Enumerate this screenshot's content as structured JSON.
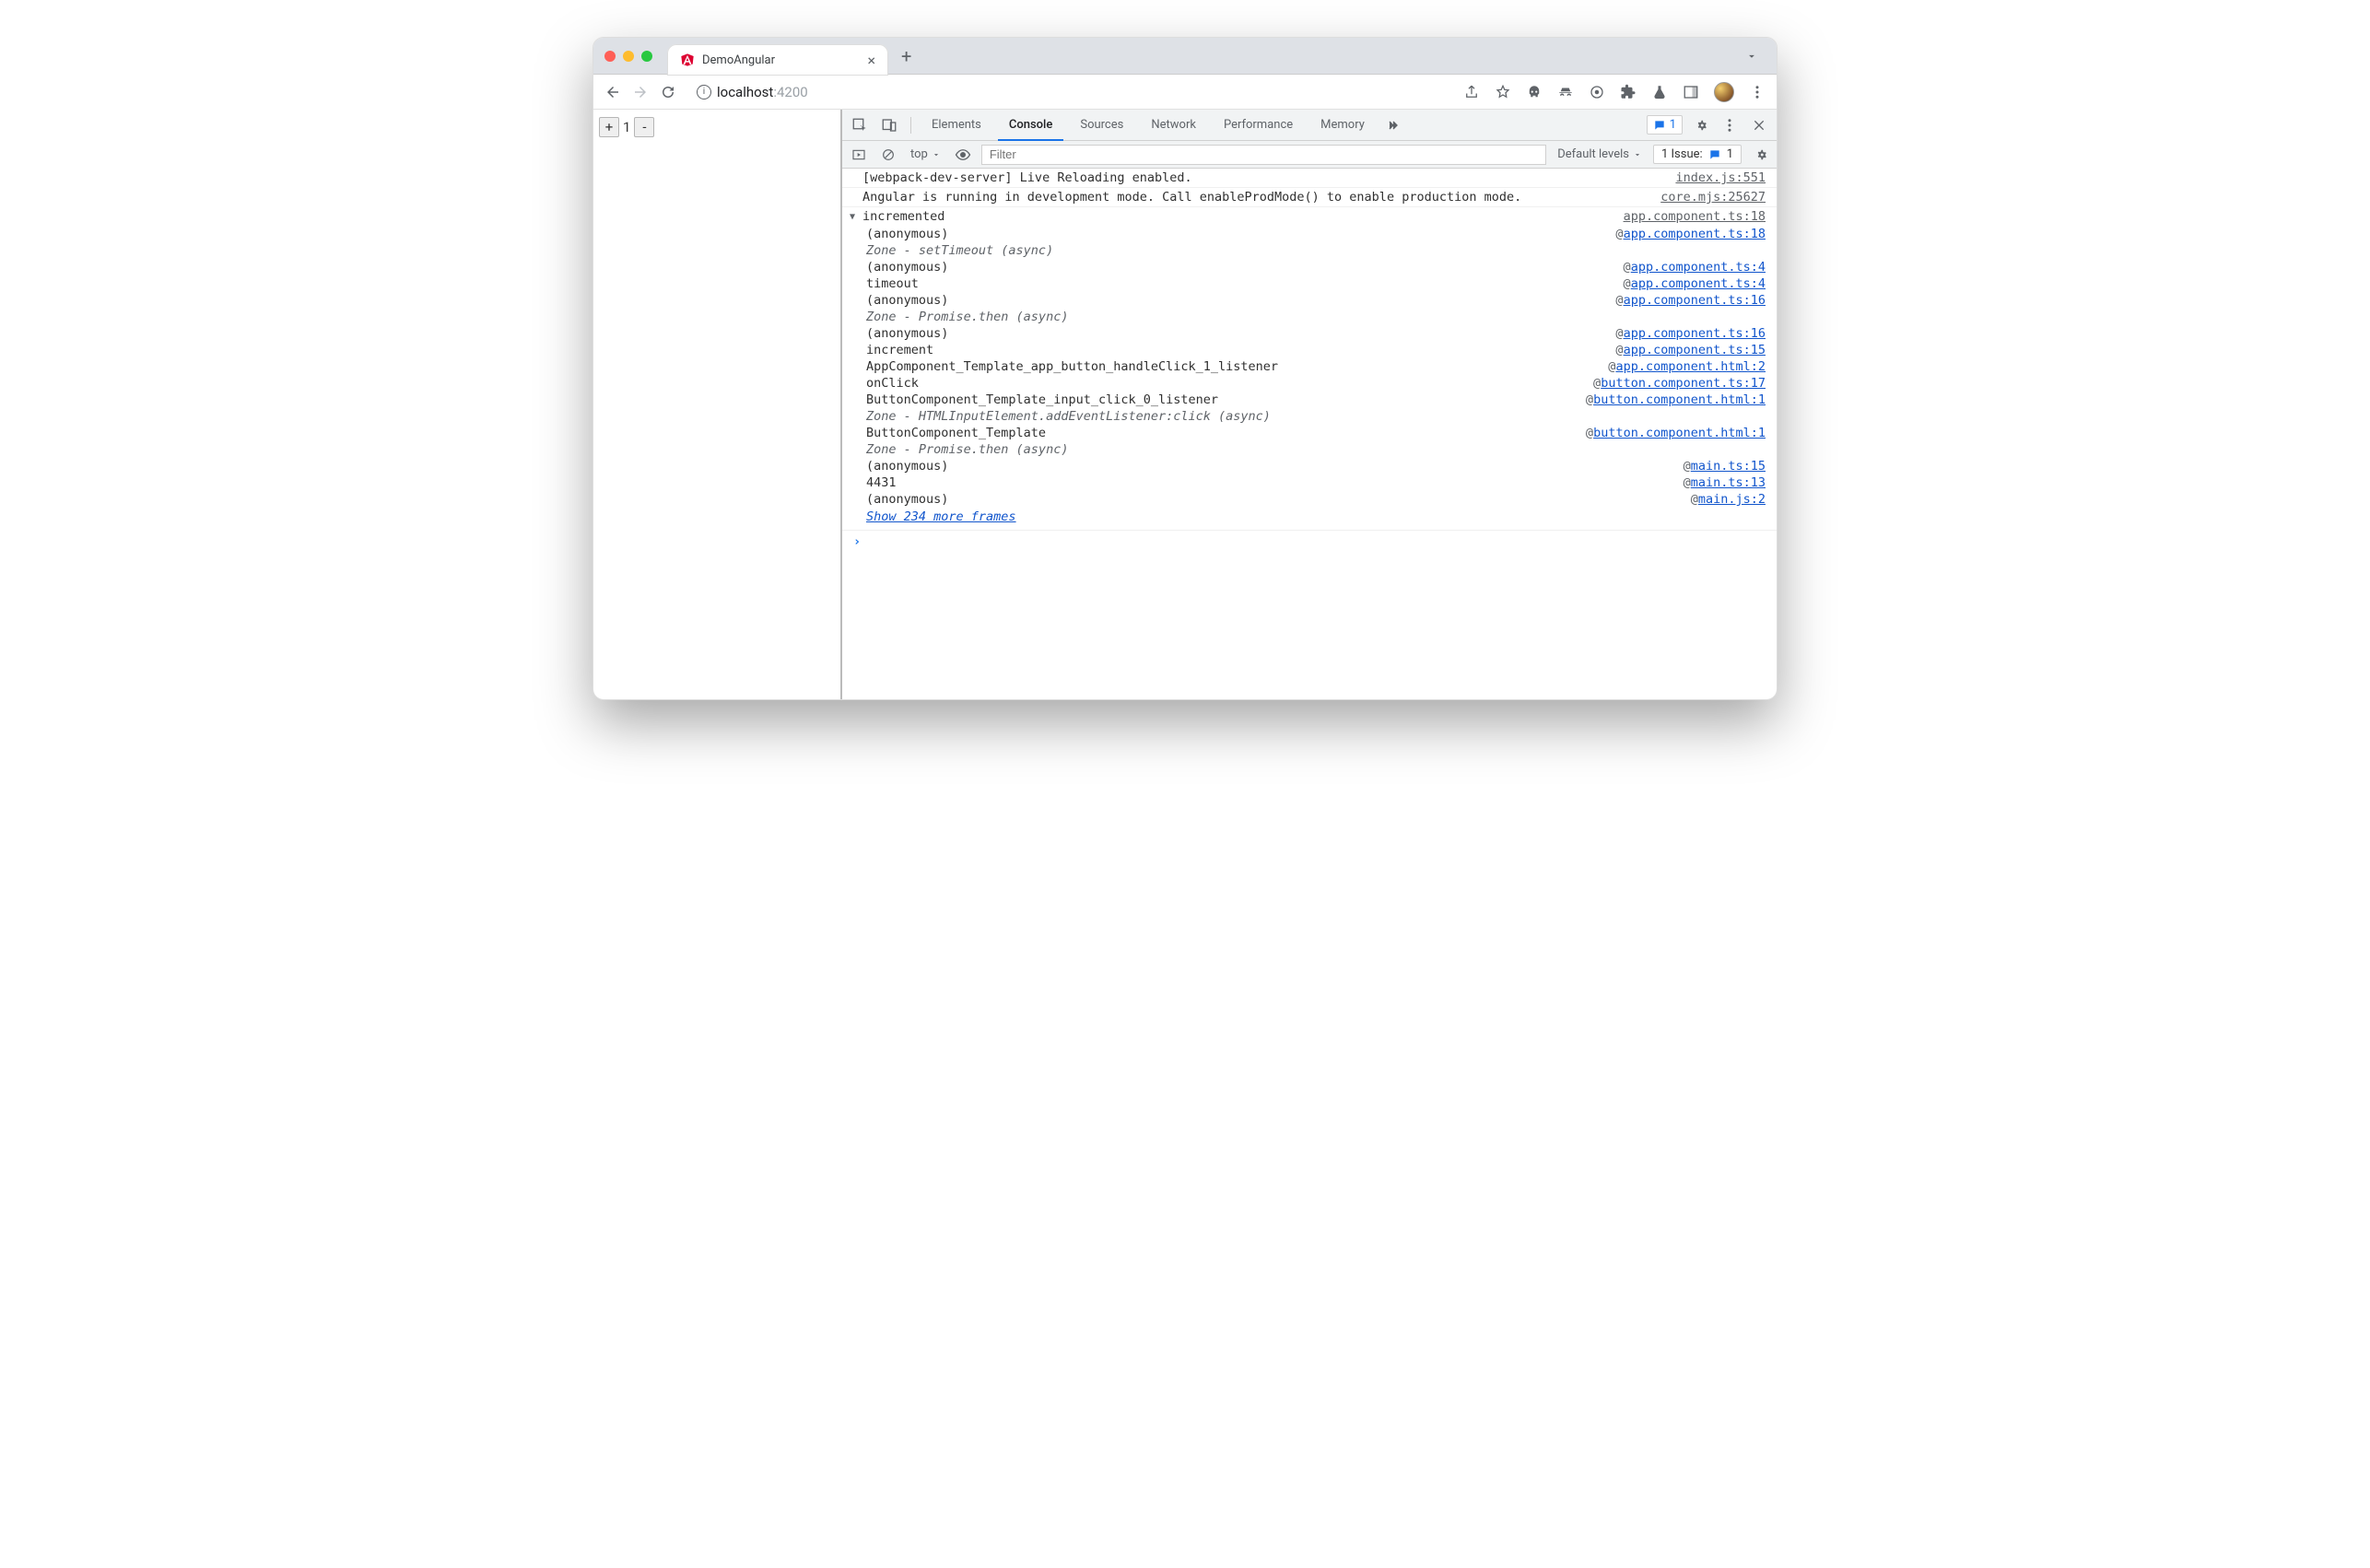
{
  "tab": {
    "title": "DemoAngular"
  },
  "url": {
    "insecure_label": "i",
    "host": "localhost",
    "port": ":4200"
  },
  "counter": {
    "plus": "+",
    "minus": "-",
    "value": "1"
  },
  "devtools": {
    "tabs": [
      "Elements",
      "Console",
      "Sources",
      "Network",
      "Performance",
      "Memory"
    ],
    "active_tab": "Console",
    "msg_badge": "1",
    "toolbar": {
      "context": "top",
      "filter_placeholder": "Filter",
      "levels": "Default levels",
      "issues_label": "1 Issue:",
      "issues_count": "1"
    }
  },
  "console": {
    "rows": [
      {
        "msg": "[webpack-dev-server] Live Reloading enabled.",
        "src": "index.js:551"
      },
      {
        "msg": "Angular is running in development mode. Call enableProdMode() to enable production mode.",
        "src": "core.mjs:25627"
      }
    ],
    "trace": {
      "label": "incremented",
      "src": "app.component.ts:18",
      "frames": [
        {
          "type": "frame",
          "fn": "(anonymous)",
          "loc": "app.component.ts:18"
        },
        {
          "type": "zone",
          "text": "Zone - setTimeout (async)"
        },
        {
          "type": "frame",
          "fn": "(anonymous)",
          "loc": "app.component.ts:4"
        },
        {
          "type": "frame",
          "fn": "timeout",
          "loc": "app.component.ts:4"
        },
        {
          "type": "frame",
          "fn": "(anonymous)",
          "loc": "app.component.ts:16"
        },
        {
          "type": "zone",
          "text": "Zone - Promise.then (async)"
        },
        {
          "type": "frame",
          "fn": "(anonymous)",
          "loc": "app.component.ts:16"
        },
        {
          "type": "frame",
          "fn": "increment",
          "loc": "app.component.ts:15"
        },
        {
          "type": "frame",
          "fn": "AppComponent_Template_app_button_handleClick_1_listener",
          "loc": "app.component.html:2"
        },
        {
          "type": "frame",
          "fn": "onClick",
          "loc": "button.component.ts:17"
        },
        {
          "type": "frame",
          "fn": "ButtonComponent_Template_input_click_0_listener",
          "loc": "button.component.html:1"
        },
        {
          "type": "zone",
          "text": "Zone - HTMLInputElement.addEventListener:click (async)"
        },
        {
          "type": "frame",
          "fn": "ButtonComponent_Template",
          "loc": "button.component.html:1"
        },
        {
          "type": "zone",
          "text": "Zone - Promise.then (async)"
        },
        {
          "type": "frame",
          "fn": "(anonymous)",
          "loc": "main.ts:15"
        },
        {
          "type": "frame",
          "fn": "4431",
          "loc": "main.ts:13"
        },
        {
          "type": "frame",
          "fn": "(anonymous)",
          "loc": "main.js:2"
        }
      ],
      "show_more": "Show 234 more frames"
    },
    "prompt": "›"
  }
}
